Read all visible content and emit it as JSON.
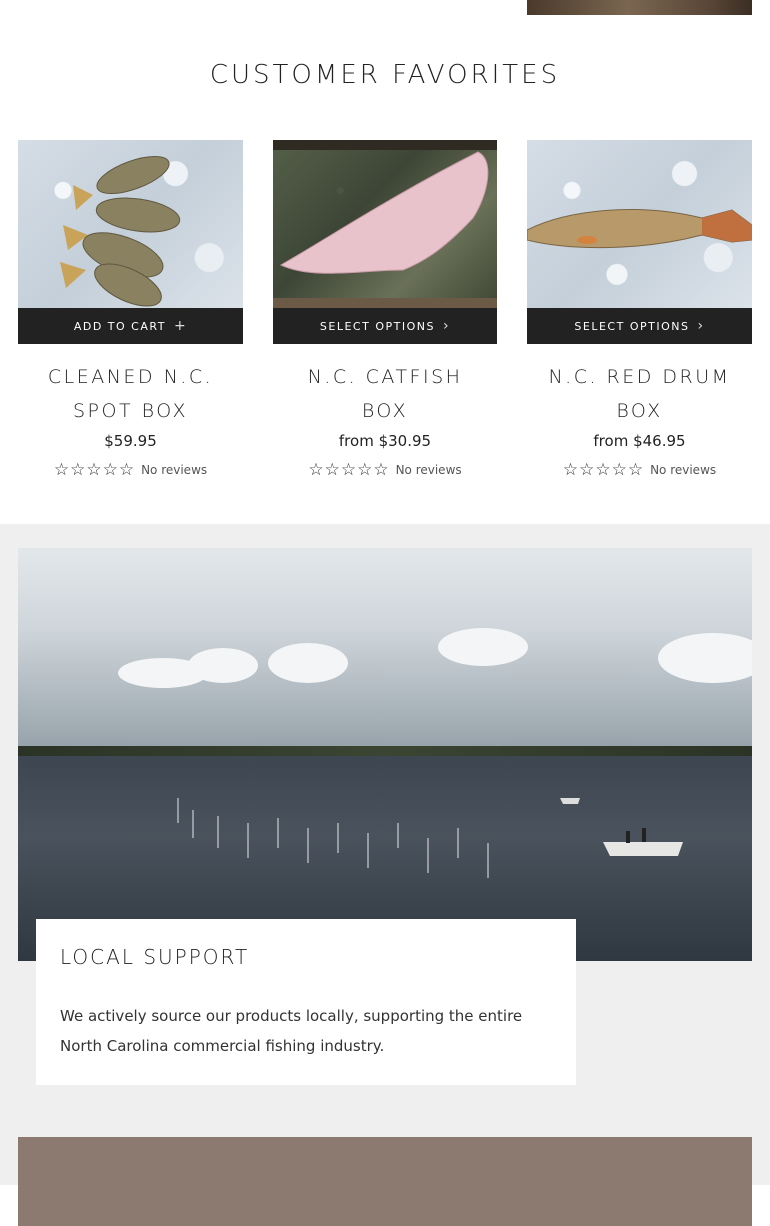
{
  "section": {
    "title": "CUSTOMER FAVORITES"
  },
  "products": [
    {
      "name": "CLEANED N.C. SPOT BOX",
      "button_label": "ADD TO CART",
      "button_icon": "plus-icon",
      "price": "$59.95",
      "stars": "☆☆☆☆☆",
      "reviews": "No reviews"
    },
    {
      "name": "N.C. CATFISH BOX",
      "button_label": "SELECT OPTIONS",
      "button_icon": "chevron-right-icon",
      "price": "from $30.95",
      "stars": "☆☆☆☆☆",
      "reviews": "No reviews"
    },
    {
      "name": "N.C. RED DRUM BOX",
      "button_label": "SELECT OPTIONS",
      "button_icon": "chevron-right-icon",
      "price": "from $46.95",
      "stars": "☆☆☆☆☆",
      "reviews": "No reviews"
    }
  ],
  "local_support": {
    "title": "LOCAL SUPPORT",
    "body": "We actively source our products locally, supporting the entire North Carolina commercial fishing industry."
  },
  "colors": {
    "button_bg": "#222222",
    "band_bg": "#efefef",
    "bottom_block": "#8c7a70"
  }
}
